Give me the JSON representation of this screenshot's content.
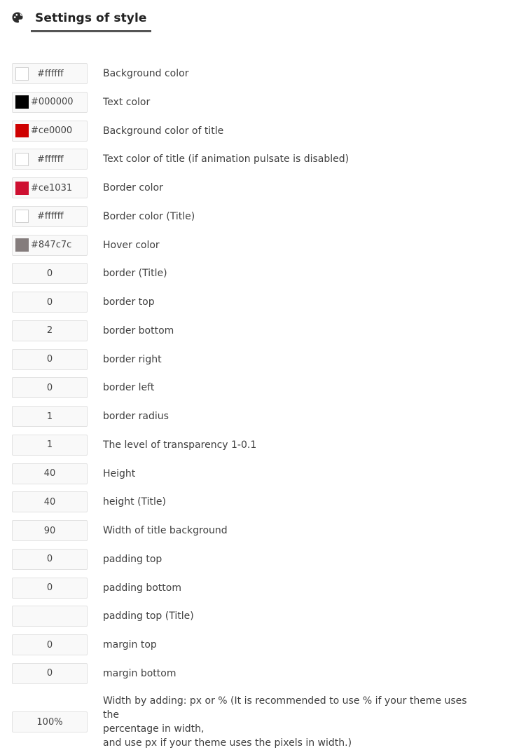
{
  "header": {
    "title": "Settings of style",
    "icon": "palette-icon"
  },
  "rows": [
    {
      "type": "color",
      "value": "#ffffff",
      "swatch": "#ffffff",
      "label": "Background color"
    },
    {
      "type": "color",
      "value": "#000000",
      "swatch": "#000000",
      "label": "Text color"
    },
    {
      "type": "color",
      "value": "#ce0000",
      "swatch": "#ce0000",
      "label": "Background color of title"
    },
    {
      "type": "color",
      "value": "#ffffff",
      "swatch": "#ffffff",
      "label": "Text color of title (if animation pulsate is disabled)"
    },
    {
      "type": "color",
      "value": "#ce1031",
      "swatch": "#ce1031",
      "label": "Border color"
    },
    {
      "type": "color",
      "value": "#ffffff",
      "swatch": "#ffffff",
      "label": "Border color (Title)"
    },
    {
      "type": "color",
      "value": "#847c7c",
      "swatch": "#847c7c",
      "label": "Hover color"
    },
    {
      "type": "number",
      "value": "0",
      "label": "border (Title)"
    },
    {
      "type": "number",
      "value": "0",
      "label": "border top"
    },
    {
      "type": "number",
      "value": "2",
      "label": "border bottom"
    },
    {
      "type": "number",
      "value": "0",
      "label": "border right"
    },
    {
      "type": "number",
      "value": "0",
      "label": "border left"
    },
    {
      "type": "number",
      "value": "1",
      "label": "border radius"
    },
    {
      "type": "number",
      "value": "1",
      "label": "The level of transparency 1-0.1"
    },
    {
      "type": "number",
      "value": "40",
      "label": "Height"
    },
    {
      "type": "number",
      "value": "40",
      "label": "height (Title)"
    },
    {
      "type": "number",
      "value": "90",
      "label": "Width of title background"
    },
    {
      "type": "number",
      "value": "0",
      "label": "padding top"
    },
    {
      "type": "number",
      "value": "0",
      "label": "padding bottom"
    },
    {
      "type": "number",
      "value": "",
      "label": "padding top (Title)"
    },
    {
      "type": "number",
      "value": "0",
      "label": "margin top"
    },
    {
      "type": "number",
      "value": "0",
      "label": "margin bottom"
    }
  ],
  "width_row": {
    "value": "100%",
    "label_lines": [
      "Width by adding: px or % (It is recommended to use % if your theme uses the",
      "percentage in width,",
      "and use px if your theme uses the pixels in width.)"
    ]
  }
}
